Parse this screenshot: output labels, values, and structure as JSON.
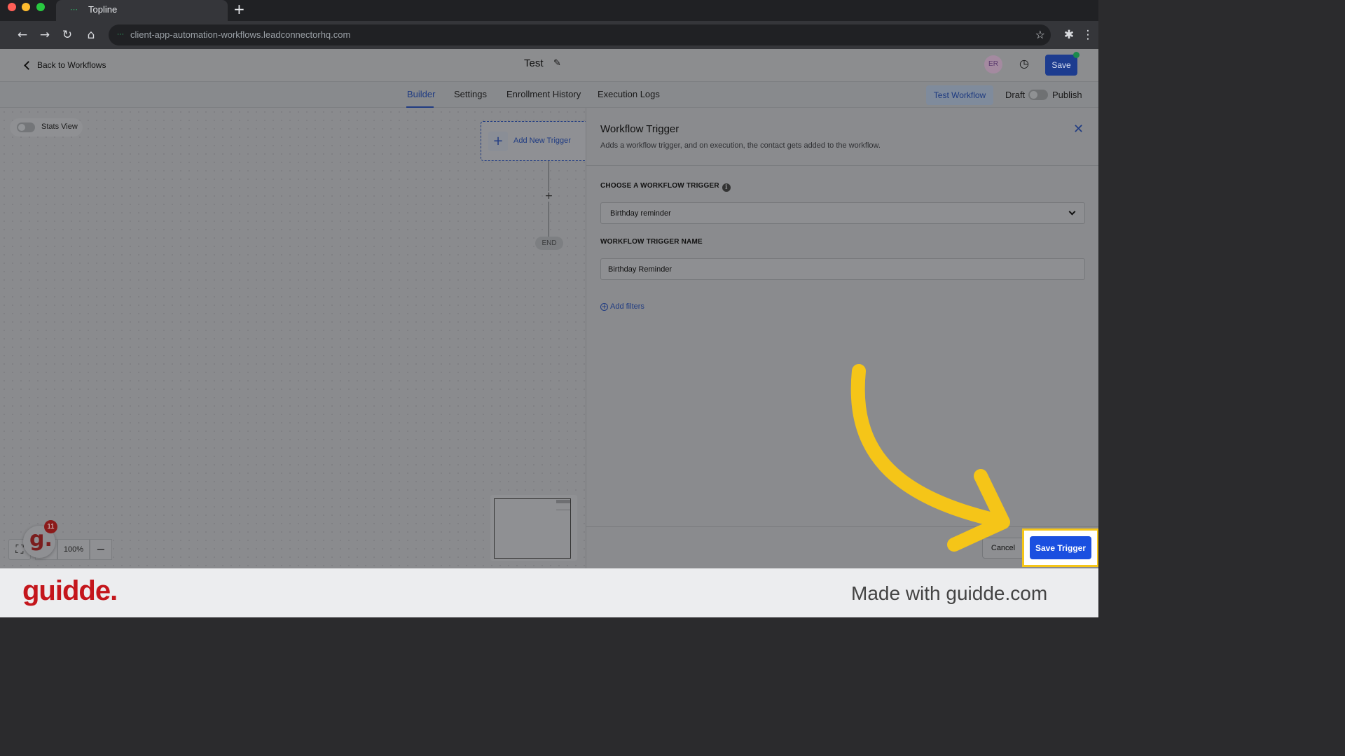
{
  "browser": {
    "tab_title": "Topline",
    "url": "client-app-automation-workflows.leadconnectorhq.com",
    "new_tab_glyph": "+",
    "icons": [
      "back-icon",
      "forward-icon",
      "reload-icon",
      "home-icon",
      "star-icon",
      "extensions-icon",
      "menu-icon"
    ]
  },
  "header": {
    "back_label": "Back to Workflows",
    "title": "Test",
    "avatar_initials": "ER",
    "save_label": "Save"
  },
  "subnav": {
    "tabs": [
      "Builder",
      "Settings",
      "Enrollment History",
      "Execution Logs"
    ],
    "active_tab": "Builder",
    "test_workflow_label": "Test Workflow",
    "draft_label": "Draft",
    "publish_label": "Publish",
    "published": false
  },
  "canvas": {
    "stats_view_label": "Stats View",
    "stats_view_on": false,
    "add_trigger_label": "Add New Trigger",
    "add_step_glyph": "+",
    "end_label": "END",
    "zoom_level": "100%"
  },
  "panel": {
    "title": "Workflow Trigger",
    "subtitle": "Adds a workflow trigger, and on execution, the contact gets added to the workflow.",
    "trigger_field_label": "CHOOSE A WORKFLOW TRIGGER",
    "trigger_value": "Birthday reminder",
    "name_field_label": "WORKFLOW TRIGGER NAME",
    "name_value": "Birthday Reminder",
    "add_filters_label": "Add filters",
    "cancel_label": "Cancel",
    "save_trigger_label": "Save Trigger"
  },
  "guidde": {
    "badge_letter": "g.",
    "badge_count": "11",
    "footer_logo": "guidde.",
    "footer_text": "Made with guidde.com"
  },
  "colors": {
    "accent_blue": "#1a4fe0",
    "highlight_yellow": "#f5c518",
    "brand_red": "#c4161c"
  }
}
